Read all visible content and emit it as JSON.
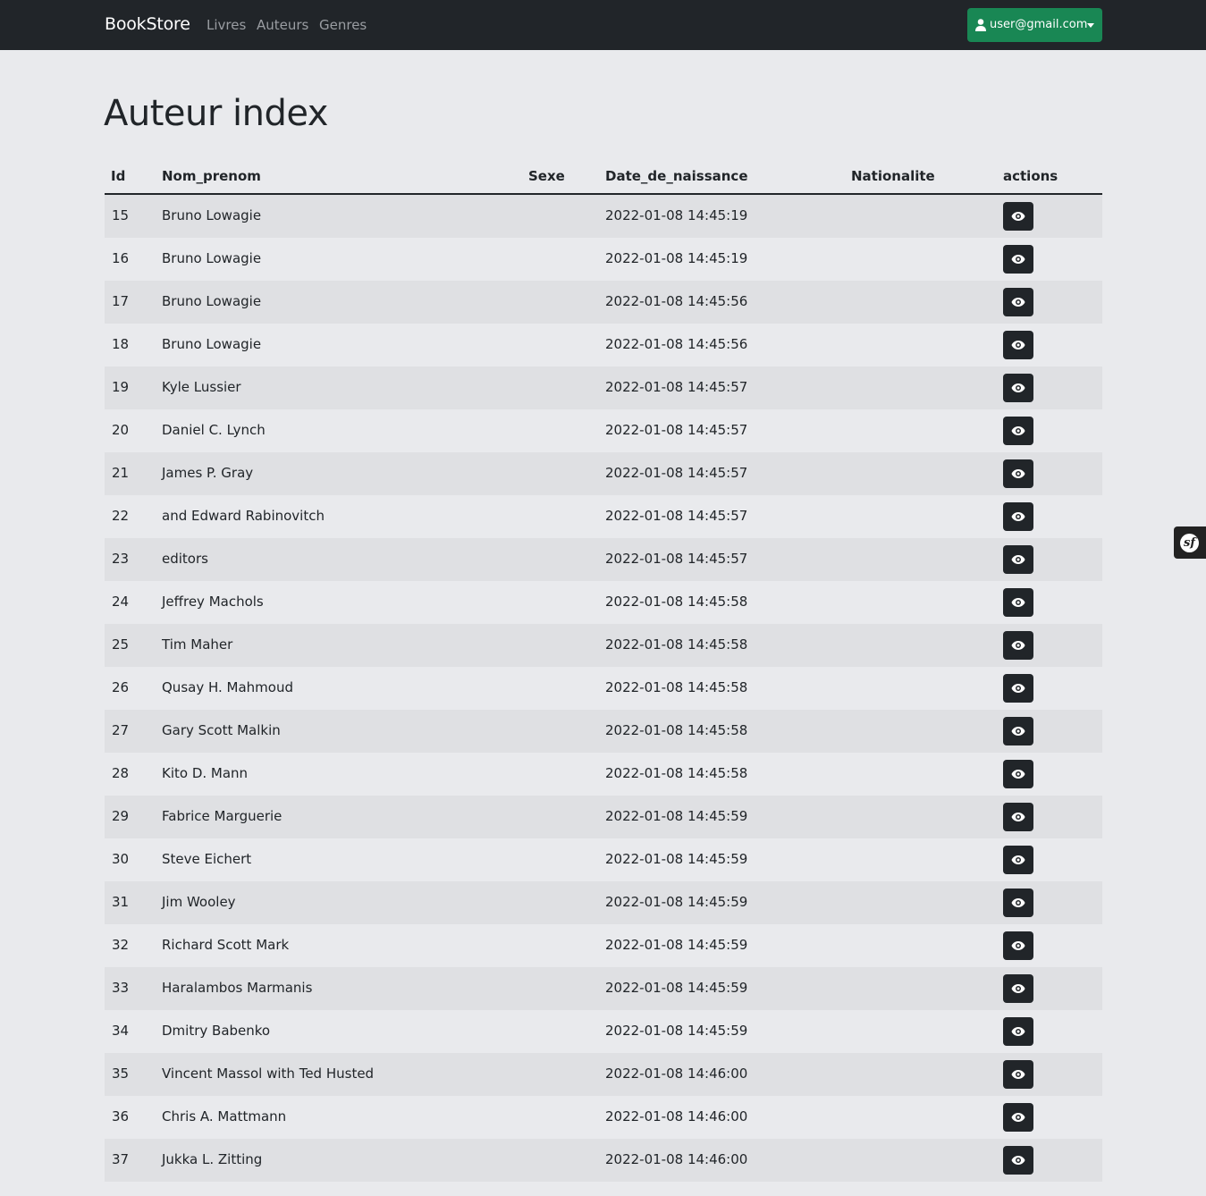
{
  "navbar": {
    "brand": "BookStore",
    "links": [
      "Livres",
      "Auteurs",
      "Genres"
    ],
    "user_email": "user@gmail.com",
    "user_icon": "person-icon",
    "accent_color": "#198754"
  },
  "page": {
    "title": "Auteur index"
  },
  "table": {
    "headers": {
      "id": "Id",
      "nom_prenom": "Nom_prenom",
      "sexe": "Sexe",
      "date": "Date_de_naissance",
      "nationalite": "Nationalite",
      "actions": "actions"
    },
    "rows": [
      {
        "id": "15",
        "nom_prenom": "Bruno Lowagie",
        "sexe": "",
        "date": "2022-01-08 14:45:19",
        "nationalite": ""
      },
      {
        "id": "16",
        "nom_prenom": "Bruno Lowagie",
        "sexe": "",
        "date": "2022-01-08 14:45:19",
        "nationalite": ""
      },
      {
        "id": "17",
        "nom_prenom": "Bruno Lowagie",
        "sexe": "",
        "date": "2022-01-08 14:45:56",
        "nationalite": ""
      },
      {
        "id": "18",
        "nom_prenom": "Bruno Lowagie",
        "sexe": "",
        "date": "2022-01-08 14:45:56",
        "nationalite": ""
      },
      {
        "id": "19",
        "nom_prenom": "Kyle Lussier",
        "sexe": "",
        "date": "2022-01-08 14:45:57",
        "nationalite": ""
      },
      {
        "id": "20",
        "nom_prenom": "Daniel C. Lynch",
        "sexe": "",
        "date": "2022-01-08 14:45:57",
        "nationalite": ""
      },
      {
        "id": "21",
        "nom_prenom": "James P. Gray",
        "sexe": "",
        "date": "2022-01-08 14:45:57",
        "nationalite": ""
      },
      {
        "id": "22",
        "nom_prenom": "and Edward Rabinovitch",
        "sexe": "",
        "date": "2022-01-08 14:45:57",
        "nationalite": ""
      },
      {
        "id": "23",
        "nom_prenom": "editors",
        "sexe": "",
        "date": "2022-01-08 14:45:57",
        "nationalite": ""
      },
      {
        "id": "24",
        "nom_prenom": "Jeffrey Machols",
        "sexe": "",
        "date": "2022-01-08 14:45:58",
        "nationalite": ""
      },
      {
        "id": "25",
        "nom_prenom": "Tim Maher",
        "sexe": "",
        "date": "2022-01-08 14:45:58",
        "nationalite": ""
      },
      {
        "id": "26",
        "nom_prenom": "Qusay H. Mahmoud",
        "sexe": "",
        "date": "2022-01-08 14:45:58",
        "nationalite": ""
      },
      {
        "id": "27",
        "nom_prenom": "Gary Scott Malkin",
        "sexe": "",
        "date": "2022-01-08 14:45:58",
        "nationalite": ""
      },
      {
        "id": "28",
        "nom_prenom": "Kito D. Mann",
        "sexe": "",
        "date": "2022-01-08 14:45:58",
        "nationalite": ""
      },
      {
        "id": "29",
        "nom_prenom": "Fabrice Marguerie",
        "sexe": "",
        "date": "2022-01-08 14:45:59",
        "nationalite": ""
      },
      {
        "id": "30",
        "nom_prenom": "Steve Eichert",
        "sexe": "",
        "date": "2022-01-08 14:45:59",
        "nationalite": ""
      },
      {
        "id": "31",
        "nom_prenom": "Jim Wooley",
        "sexe": "",
        "date": "2022-01-08 14:45:59",
        "nationalite": ""
      },
      {
        "id": "32",
        "nom_prenom": "Richard Scott Mark",
        "sexe": "",
        "date": "2022-01-08 14:45:59",
        "nationalite": ""
      },
      {
        "id": "33",
        "nom_prenom": "Haralambos Marmanis",
        "sexe": "",
        "date": "2022-01-08 14:45:59",
        "nationalite": ""
      },
      {
        "id": "34",
        "nom_prenom": "Dmitry Babenko",
        "sexe": "",
        "date": "2022-01-08 14:45:59",
        "nationalite": ""
      },
      {
        "id": "35",
        "nom_prenom": "Vincent Massol with Ted Husted",
        "sexe": "",
        "date": "2022-01-08 14:46:00",
        "nationalite": ""
      },
      {
        "id": "36",
        "nom_prenom": "Chris A. Mattmann",
        "sexe": "",
        "date": "2022-01-08 14:46:00",
        "nationalite": ""
      },
      {
        "id": "37",
        "nom_prenom": "Jukka L. Zitting",
        "sexe": "",
        "date": "2022-01-08 14:46:00",
        "nationalite": ""
      }
    ],
    "row_action_icon": "eye-icon"
  },
  "debug_toolbar": {
    "icon": "symfony-logo-icon",
    "logo_text": "sf"
  }
}
